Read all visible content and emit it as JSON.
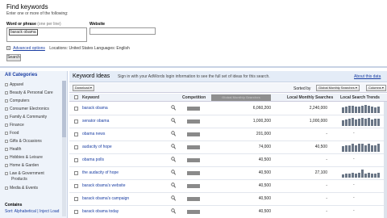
{
  "header": {
    "title": "Find keywords",
    "subtitle": "Enter one or more of the following:",
    "word_label": "Word or phrase",
    "word_note": "(one per line)",
    "word_value": "barack obama",
    "website_label": "Website",
    "advanced_label": "Advanced options",
    "locations": "Locations: United States  Languages: English",
    "search_button": "Search"
  },
  "sidebar": {
    "heading": "All Categories",
    "items": [
      {
        "label": "Apparel"
      },
      {
        "label": "Beauty & Personal Care"
      },
      {
        "label": "Computers"
      },
      {
        "label": "Consumer Electronics"
      },
      {
        "label": "Family & Community"
      },
      {
        "label": "Finance"
      },
      {
        "label": "Food"
      },
      {
        "label": "Gifts & Occasions"
      },
      {
        "label": "Health"
      },
      {
        "label": "Hobbies & Leisure"
      },
      {
        "label": "Home & Garden"
      },
      {
        "label": "Law & Government"
      },
      {
        "label": "Products"
      },
      {
        "label": "Media & Events"
      }
    ],
    "contains_label": "Contains",
    "sort_text": "Sort: Alphabetical | Inject Load"
  },
  "results": {
    "title": "Keyword Ideas",
    "signin_text": "Sign in with your AdWords login information to see the full set of ideas for this search.",
    "about_link": "About this data",
    "download_button": "Download",
    "sorted_label": "Sorted by",
    "sorted_value": "Global Monthly Searches",
    "columns_button": "Columns",
    "columns": {
      "keyword": "Keyword",
      "competition": "Competition",
      "global": "Global Monthly Searches",
      "local": "Local Monthly Searches",
      "trends": "Local Search Trends"
    },
    "rows": [
      {
        "keyword": "barack obama",
        "global": "6,060,200",
        "local": "2,240,000",
        "trend": [
          7,
          8,
          9,
          9,
          8,
          8,
          9,
          10,
          9,
          8,
          7,
          8
        ]
      },
      {
        "keyword": "senator obama",
        "global": "1,000,200",
        "local": "1,000,000",
        "trend": [
          6,
          7,
          8,
          9,
          7,
          8,
          9,
          8,
          9,
          7,
          8,
          8
        ]
      },
      {
        "keyword": "obama news",
        "global": "201,000",
        "local": "-",
        "trend": []
      },
      {
        "keyword": "audacity of hope",
        "global": "74,000",
        "local": "40,500",
        "trend": [
          4,
          5,
          5,
          6,
          5,
          6,
          6,
          5,
          6,
          5,
          5,
          6
        ]
      },
      {
        "keyword": "obama polls",
        "global": "40,500",
        "local": "-",
        "trend": []
      },
      {
        "keyword": "the audacity of hope",
        "global": "40,500",
        "local": "27,100",
        "trend": [
          3,
          4,
          4,
          5,
          4,
          5,
          8,
          4,
          5,
          4,
          4,
          5
        ]
      },
      {
        "keyword": "barack obama's website",
        "global": "40,500",
        "local": "-",
        "trend": []
      },
      {
        "keyword": "barack obama's campaign",
        "global": "40,500",
        "local": "-",
        "trend": []
      },
      {
        "keyword": "barack obama today",
        "global": "40,500",
        "local": "-",
        "trend": []
      }
    ]
  }
}
